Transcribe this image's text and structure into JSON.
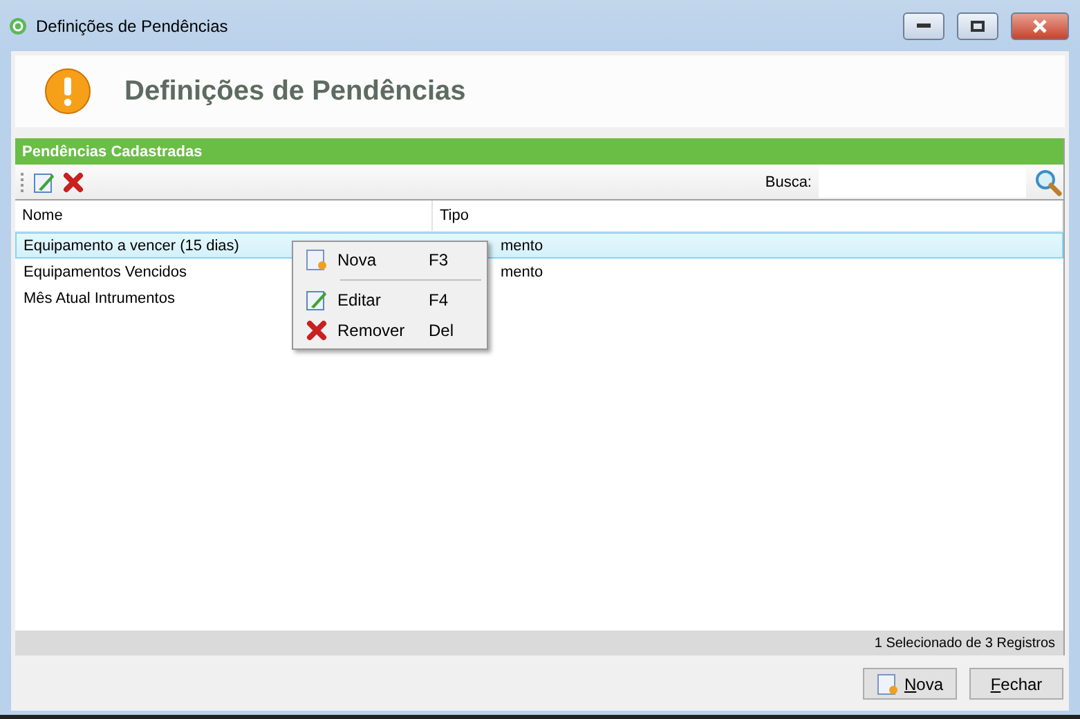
{
  "window": {
    "title": "Definições de Pendências"
  },
  "header": {
    "title": "Definições de Pendências"
  },
  "panel": {
    "title": "Pendências Cadastradas"
  },
  "search": {
    "label": "Busca:"
  },
  "table": {
    "columns": [
      "Nome",
      "Tipo"
    ],
    "rows": [
      {
        "nome": "Equipamento a vencer (15 dias)",
        "tipo": "mento",
        "selected": true
      },
      {
        "nome": "Equipamentos Vencidos",
        "tipo": "mento",
        "selected": false
      },
      {
        "nome": "Mês Atual Intrumentos",
        "selected": false
      }
    ]
  },
  "context_menu": [
    {
      "kind": "new",
      "label": "Nova",
      "shortcut": "F3"
    },
    {
      "kind": "separator"
    },
    {
      "kind": "edit",
      "label": "Editar",
      "shortcut": "F4"
    },
    {
      "kind": "remove",
      "label": "Remover",
      "shortcut": "Del"
    }
  ],
  "status": "1 Selecionado de 3 Registros",
  "buttons": [
    {
      "kind": "new",
      "label": "Nova"
    },
    {
      "kind": "close",
      "label": "Fechar"
    }
  ]
}
